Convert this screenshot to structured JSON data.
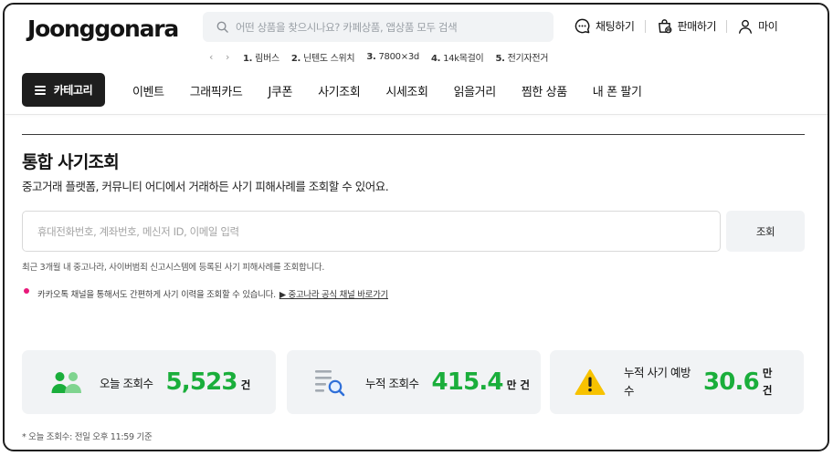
{
  "brand": {
    "logo": "Joonggonara"
  },
  "search": {
    "placeholder": "어떤 상품을 찾으시나요? 카페상품, 앱상품 모두 검색"
  },
  "header_actions": [
    {
      "label": "채팅하기",
      "icon": "chat-icon"
    },
    {
      "label": "판매하기",
      "icon": "sell-bag-icon"
    },
    {
      "label": "마이",
      "icon": "user-icon"
    }
  ],
  "popular_keywords": [
    {
      "rank": "1.",
      "text": "림버스"
    },
    {
      "rank": "2.",
      "text": "닌텐도 스위치"
    },
    {
      "rank": "3.",
      "text": "7800×3d"
    },
    {
      "rank": "4.",
      "text": "14k목걸이"
    },
    {
      "rank": "5.",
      "text": "전기자전거"
    }
  ],
  "nav": {
    "category_label": "카테고리",
    "items": [
      "이벤트",
      "그래픽카드",
      "J쿠폰",
      "사기조회",
      "시세조회",
      "읽을거리",
      "찜한 상품",
      "내 폰 팔기"
    ]
  },
  "page": {
    "title": "통합 사기조회",
    "subtitle": "중고거래 플랫폼, 커뮤니티 어디에서 거래하든 사기 피해사례를 조회할 수 있어요.",
    "input_placeholder": "휴대전화번호, 계좌번호, 메신저 ID, 이메일 입력",
    "lookup_button": "조회",
    "note": "최근 3개월 내 중고나라, 사이버범죄 신고시스템에 등록된 사기 피해사례를 조회합니다.",
    "kakao_text": "카카오톡 채널을 통해서도 간편하게 사기 이력을 조회할 수 있습니다.",
    "kakao_link": "▶ 중고나라 공식 채널 바로가기",
    "footnote": "* 오늘 조회수: 전일 오후 11:59 기준"
  },
  "stats": [
    {
      "label": "오늘 조회수",
      "value": "5,523",
      "unit": "건",
      "icon": "users-icon"
    },
    {
      "label": "누적 조회수",
      "value": "415.4",
      "unit": "만 건",
      "icon": "list-search-icon"
    },
    {
      "label_line1": "누적 사기 예방",
      "label_line2": "수",
      "value": "30.6",
      "unit_line1": "만",
      "unit_line2": "건",
      "icon": "warning-icon"
    }
  ],
  "colors": {
    "accent_green": "#1aae3b",
    "dark": "#1e1e1e",
    "warning_yellow": "#f7c200",
    "kakao_dot": "#e8197a"
  }
}
